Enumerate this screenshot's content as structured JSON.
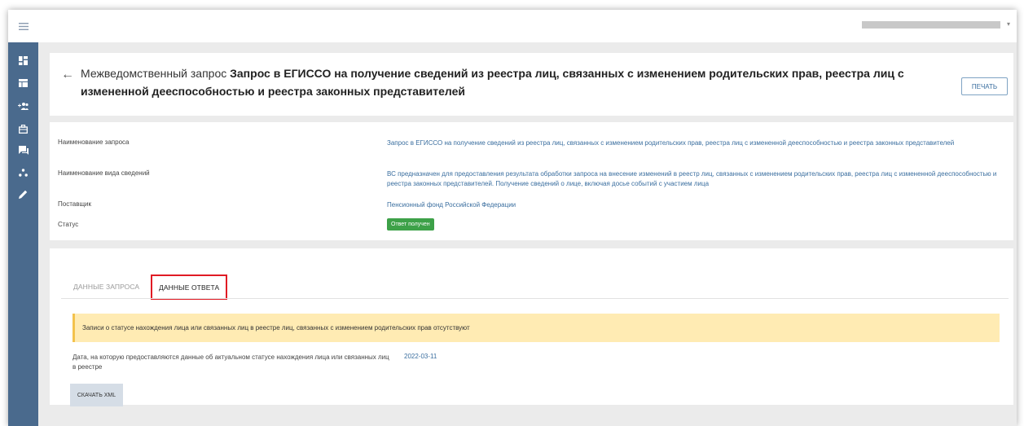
{
  "topbar": {
    "menu_icon": "hamburger-icon",
    "user_caret": "▾"
  },
  "sidebar": {
    "items": [
      {
        "icon": "dashboard-icon"
      },
      {
        "icon": "grid-icon"
      },
      {
        "icon": "users-add-icon"
      },
      {
        "icon": "briefcase-icon"
      },
      {
        "icon": "chat-icon"
      },
      {
        "icon": "hierarchy-icon"
      },
      {
        "icon": "pencil-icon"
      }
    ]
  },
  "header": {
    "back": "←",
    "prefix": "Межведомственный запрос",
    "title": "Запрос в ЕГИССО на получение сведений из реестра лиц, связанных с изменением родительских прав, реестра лиц с измененной дееспособностью и реестра законных представителей",
    "print_label": "ПЕЧАТЬ"
  },
  "info": {
    "request_name_label": "Наименование запроса",
    "request_name_value": "Запрос в ЕГИССО на получение сведений из реестра лиц, связанных с изменением родительских прав, реестра лиц с измененной дееспособностью и реестра законных представителей",
    "info_kind_label": "Наименование вида сведений",
    "info_kind_value": "ВС предназначен для предоставления результата обработки запроса на внесение изменений в реестр лиц, связанных с изменением родительских прав, реестра лиц с измененной дееспособностью и реестра законных представителей. Получение сведений о лице, включая досье событий с участием лица",
    "provider_label": "Поставщик",
    "provider_value": "Пенсионный фонд Российской Федерации",
    "status_label": "Статус",
    "status_value": "Ответ получен",
    "status_color": "#3da148"
  },
  "tabs": {
    "request_label": "ДАННЫЕ ЗАПРОСА",
    "response_label": "ДАННЫЕ ОТВЕТА"
  },
  "response": {
    "warning_text": "Записи о статусе нахождения лица или связанных лиц в реестре лиц, связанных с изменением родительских прав отсутствуют",
    "date_label": "Дата, на которую предоставляются данные об актуальном статусе нахождения лица или связанных лиц в реестре",
    "date_value": "2022-03-11",
    "download_label": "СКАЧАТЬ XML"
  }
}
